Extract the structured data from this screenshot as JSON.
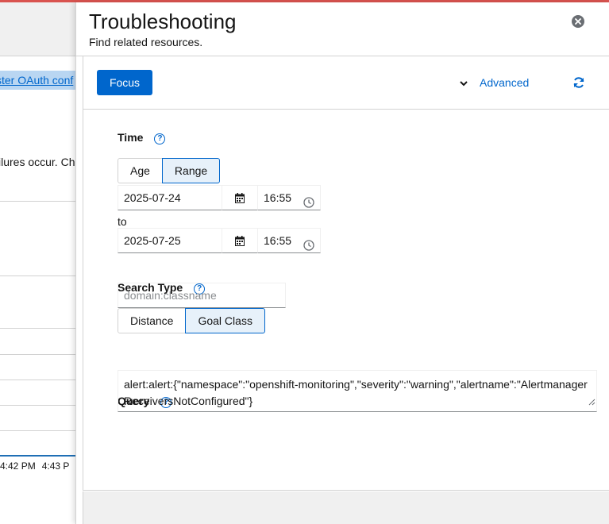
{
  "background": {
    "link_text": "ster OAuth conf",
    "body_text": "ilures occur. Ch",
    "time_ticks": [
      "4:42 PM",
      "4:43 P"
    ]
  },
  "drawer": {
    "title": "Troubleshooting",
    "subtitle": "Find related resources."
  },
  "toolbar": {
    "focus_label": "Focus",
    "advanced_label": "Advanced"
  },
  "time": {
    "label": "Time",
    "mode_options": [
      "Age",
      "Range"
    ],
    "selected_mode": "Range",
    "start_date": "2025-07-24",
    "start_time": "16:55",
    "to_label": "to",
    "end_date": "2025-07-25",
    "end_time": "16:55"
  },
  "search_type": {
    "label": "Search Type",
    "options": [
      "Distance",
      "Goal Class"
    ],
    "selected": "Goal Class",
    "class_placeholder": "domain:classname"
  },
  "query": {
    "label": "Query",
    "value": "alert:alert:{\"namespace\":\"openshift-monitoring\",\"severity\":\"warning\",\"alertname\":\"AlertmanagerReceiversNotConfigured\"}"
  },
  "colors": {
    "accent": "#0066cc",
    "selected_bg": "#e7f1fa",
    "top_accent": "#d9534f"
  }
}
